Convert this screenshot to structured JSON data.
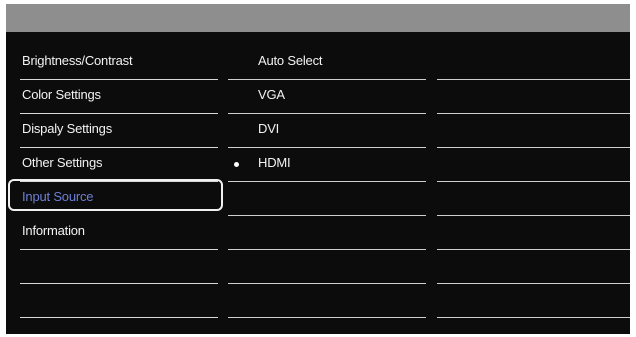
{
  "osd": {
    "menu": [
      {
        "label": "Brightness/Contrast",
        "selected": false
      },
      {
        "label": "Color Settings",
        "selected": false
      },
      {
        "label": "Dispaly Settings",
        "selected": false
      },
      {
        "label": "Other Settings",
        "selected": false
      },
      {
        "label": "Input Source",
        "selected": true
      },
      {
        "label": "Information",
        "selected": false
      }
    ],
    "submenu": [
      {
        "label": "Auto Select",
        "active": false
      },
      {
        "label": "VGA",
        "active": false
      },
      {
        "label": "DVI",
        "active": false
      },
      {
        "label": "HDMI",
        "active": true
      }
    ],
    "colors": {
      "background": "#0c0c0c",
      "header": "#8e8e8e",
      "selected_text": "#6e7fd6",
      "divider": "#cfcfcf"
    }
  }
}
